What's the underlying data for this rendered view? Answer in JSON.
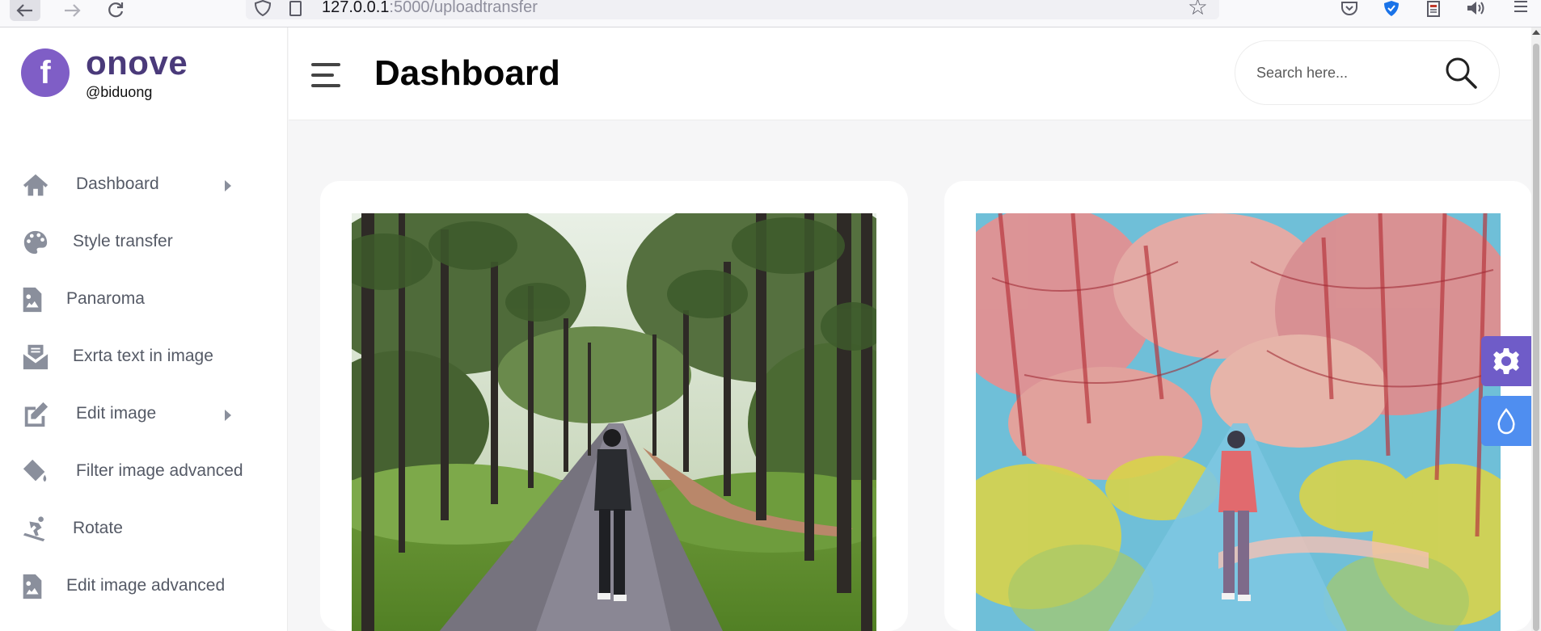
{
  "browser": {
    "url_host": "127.0.0.1",
    "url_port_path": ":5000/uploadtransfer"
  },
  "brand": {
    "logo_letter": "f",
    "name": "onove",
    "handle": "@biduong"
  },
  "sidebar": {
    "items": [
      {
        "label": "Dashboard",
        "icon": "home-icon",
        "has_submenu": true
      },
      {
        "label": "Style transfer",
        "icon": "palette-icon",
        "has_submenu": false
      },
      {
        "label": "Panaroma",
        "icon": "image-file-icon",
        "has_submenu": false
      },
      {
        "label": "Exrta text in image",
        "icon": "mail-bulk-icon",
        "has_submenu": false
      },
      {
        "label": "Edit image",
        "icon": "edit-icon",
        "has_submenu": true
      },
      {
        "label": "Filter image advanced",
        "icon": "paint-bucket-icon",
        "has_submenu": false
      },
      {
        "label": "Rotate",
        "icon": "snowboarding-icon",
        "has_submenu": false
      },
      {
        "label": "Edit image advanced",
        "icon": "image-file-icon",
        "has_submenu": false
      }
    ]
  },
  "header": {
    "title": "Dashboard",
    "search_placeholder": "Search here..."
  },
  "colors": {
    "brand": "#7f5ec6",
    "settings_button": "#6f5cc8",
    "theme_button": "#4f8ef0",
    "sidebar_icon": "#8a8f9c"
  }
}
